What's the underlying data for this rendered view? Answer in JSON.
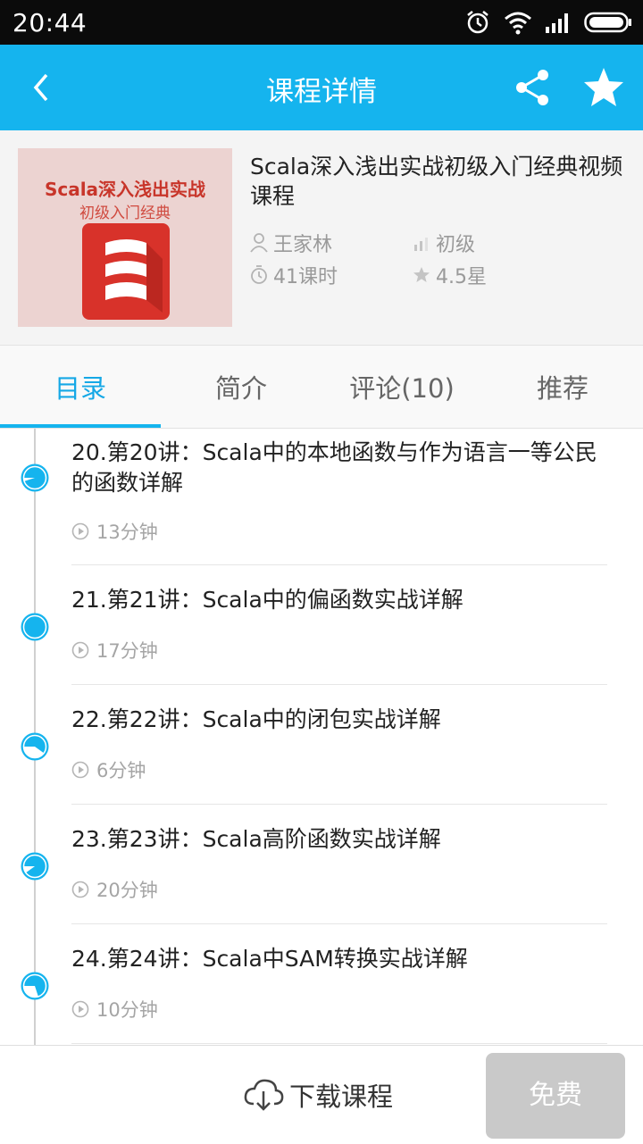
{
  "status_bar": {
    "time": "20:44"
  },
  "header": {
    "title": "课程详情"
  },
  "course": {
    "thumbnail_title": "Scala深入浅出实战",
    "thumbnail_subtitle": "初级入门经典",
    "title": "Scala深入浅出实战初级入门经典视频课程",
    "teacher": "王家林",
    "level": "初级",
    "hours": "41课时",
    "rating": "4.5星"
  },
  "tabs": [
    {
      "label": "目录",
      "active": true
    },
    {
      "label": "简介",
      "active": false
    },
    {
      "label": "评论(10)",
      "active": false
    },
    {
      "label": "推荐",
      "active": false
    }
  ],
  "lessons": [
    {
      "title": "20.第20讲：Scala中的本地函数与作为语言一等公民的函数详解",
      "duration": "13分钟",
      "progress": 0.05
    },
    {
      "title": "21.第21讲：Scala中的偏函数实战详解",
      "duration": "17分钟",
      "progress": 0.0
    },
    {
      "title": "22.第22讲：Scala中的闭包实战详解",
      "duration": "6分钟",
      "progress": 0.4
    },
    {
      "title": "23.第23讲：Scala高阶函数实战详解",
      "duration": "20分钟",
      "progress": 0.1
    },
    {
      "title": "24.第24讲：Scala中SAM转换实战详解",
      "duration": "10分钟",
      "progress": 0.3
    }
  ],
  "bottom": {
    "download_label": "下载课程",
    "free_label": "免费"
  },
  "colors": {
    "accent": "#15b4ee",
    "free_button": "#c9c9c9",
    "thumb_logo": "#d8322a"
  }
}
